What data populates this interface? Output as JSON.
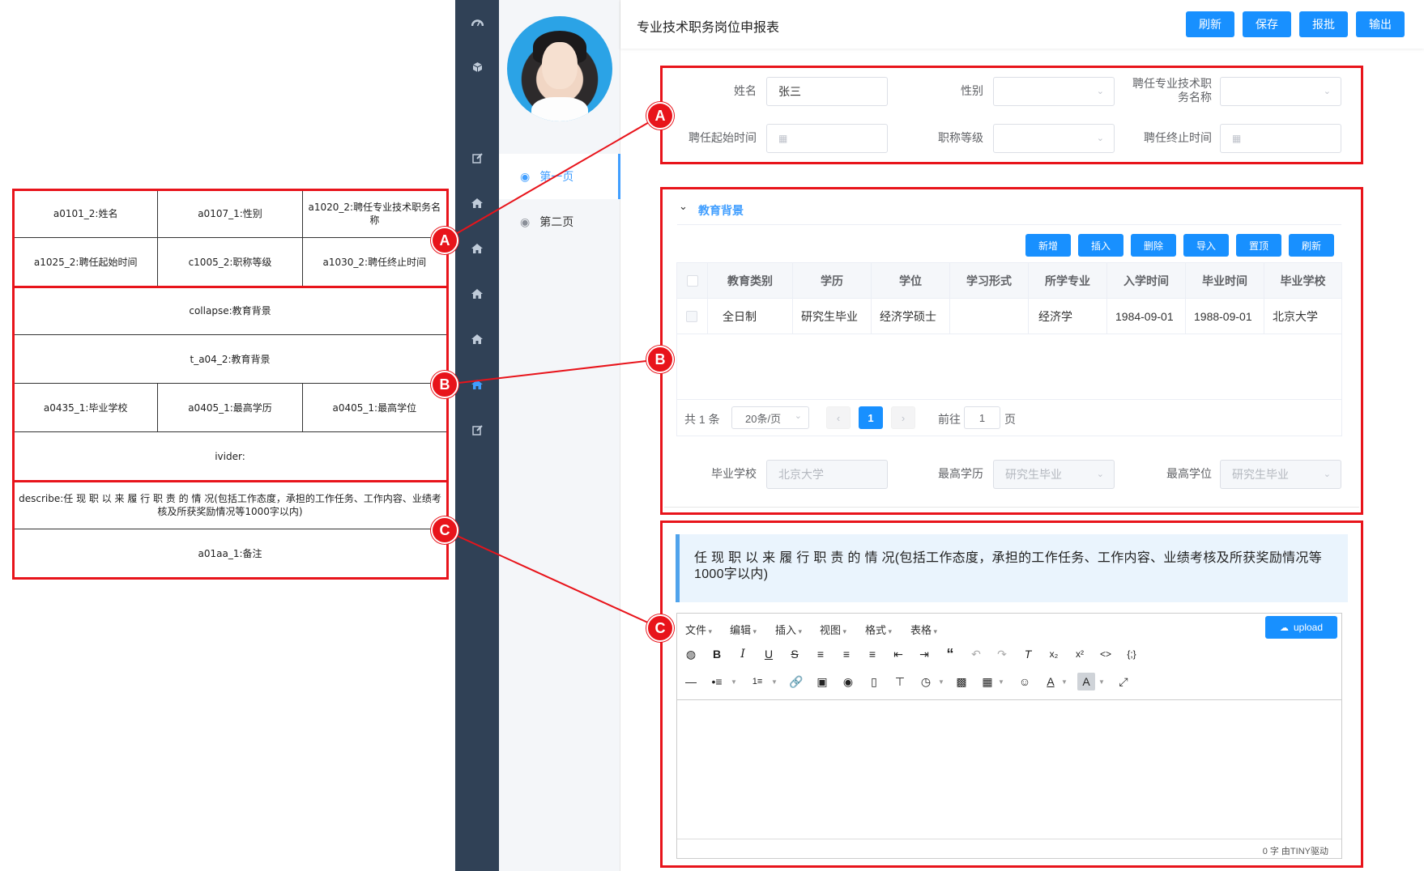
{
  "schema": {
    "rows": [
      [
        "a0101_2:姓名",
        "a0107_1:性别",
        "a1020_2:聘任专业技术职务名称"
      ],
      [
        "a1025_2:聘任起始时间",
        "c1005_2:职称等级",
        "a1030_2:聘任终止时间"
      ],
      [
        "collapse:教育背景"
      ],
      [
        "t_a04_2:教育背景"
      ],
      [
        "a0435_1:毕业学校",
        "a0405_1:最高学历",
        "a0405_1:最高学位"
      ],
      [
        "ivider:"
      ],
      [
        "describe:任 现 职 以 来 履 行 职 责 的 情 况(包括工作态度，承担的工作任务、工作内容、业绩考核及所获奖励情况等1000字以内)"
      ],
      [
        "a01aa_1:备注"
      ]
    ]
  },
  "markers": {
    "a": "A",
    "b": "B",
    "c": "C"
  },
  "sidebar": {
    "icons": [
      "dashboard-icon",
      "cube-icon",
      "edit-icon",
      "home-icon",
      "home-icon",
      "home-icon",
      "home-icon",
      "home-icon",
      "edit-icon"
    ],
    "active_index": 7
  },
  "pages": {
    "items": [
      "第一页",
      "第二页"
    ],
    "active": 0
  },
  "header": {
    "title": "专业技术职务岗位申报表",
    "buttons": [
      "刷新",
      "保存",
      "报批",
      "输出"
    ]
  },
  "form": {
    "name_label": "姓名",
    "name_value": "张三",
    "gender_label": "性别",
    "position_label_1": "聘任专业技术职",
    "position_label_2": "务名称",
    "start_label": "聘任起始时间",
    "level_label": "职称等级",
    "end_label": "聘任终止时间"
  },
  "education": {
    "title": "教育背景",
    "buttons": [
      "新增",
      "插入",
      "删除",
      "导入",
      "置顶",
      "刷新"
    ],
    "columns": [
      "教育类别",
      "学历",
      "学位",
      "学习形式",
      "所学专业",
      "入学时间",
      "毕业时间",
      "毕业学校"
    ],
    "rows": [
      [
        "全日制",
        "研究生毕业",
        "经济学硕士",
        "",
        "经济学",
        "1984-09-01",
        "1988-09-01",
        "北京大学"
      ]
    ],
    "pagination": {
      "total": "共 1 条",
      "page_size": "20条/页",
      "current": "1",
      "goto_prefix": "前往",
      "goto_value": "1",
      "goto_suffix": "页"
    },
    "school_label": "毕业学校",
    "school_value": "北京大学",
    "degree_label": "最高学历",
    "degree_value": "研究生毕业",
    "highdeg_label": "最高学位",
    "highdeg_value": "研究生毕业"
  },
  "describe": {
    "text": "任 现 职 以 来 履 行 职 责 的 情 况(包括工作态度，承担的工作任务、工作内容、业绩考核及所获奖励情况等1000字以内)"
  },
  "editor": {
    "menus": [
      "文件",
      "编辑",
      "插入",
      "视图",
      "格式",
      "表格"
    ],
    "upload_label": "upload",
    "status": "0 字 由TINY驱动"
  },
  "colors": {
    "accent": "#1890ff",
    "annotation": "#e8141b",
    "sidebar": "#304156"
  }
}
